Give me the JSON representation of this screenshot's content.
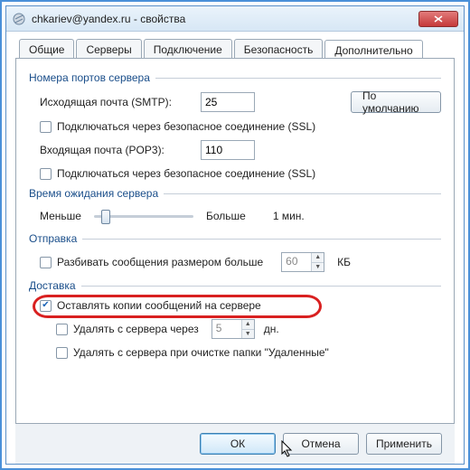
{
  "window": {
    "title": "chkariev@yandex.ru - свойства"
  },
  "tabs": {
    "items": [
      {
        "label": "Общие"
      },
      {
        "label": "Серверы"
      },
      {
        "label": "Подключение"
      },
      {
        "label": "Безопасность"
      },
      {
        "label": "Дополнительно"
      }
    ],
    "active": 4
  },
  "groups": {
    "ports": {
      "title": "Номера портов сервера",
      "smtp_label": "Исходящая почта (SMTP):",
      "smtp_value": "25",
      "defaults_btn": "По умолчанию",
      "smtp_ssl": "Подключаться через безопасное соединение (SSL)",
      "pop3_label": "Входящая почта (POP3):",
      "pop3_value": "110",
      "pop3_ssl": "Подключаться через безопасное соединение (SSL)"
    },
    "timeout": {
      "title": "Время ожидания сервера",
      "less": "Меньше",
      "more": "Больше",
      "value": "1 мин."
    },
    "sending": {
      "title": "Отправка",
      "split_label": "Разбивать сообщения размером больше",
      "split_value": "60",
      "split_unit": "КБ"
    },
    "delivery": {
      "title": "Доставка",
      "leave_copies": "Оставлять копии сообщений на сервере",
      "remove_after_label": "Удалять с сервера через",
      "remove_after_value": "5",
      "remove_after_unit": "дн.",
      "remove_on_purge": "Удалять с сервера при очистке папки \"Удаленные\""
    }
  },
  "footer": {
    "ok": "ОК",
    "cancel": "Отмена",
    "apply": "Применить"
  }
}
